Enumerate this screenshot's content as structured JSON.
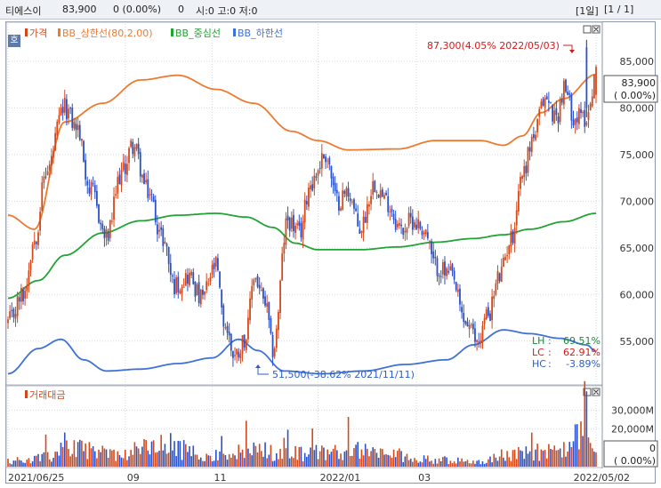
{
  "header": {
    "name": "티에스이",
    "price": "83,900",
    "change": "0 (0.00%)",
    "volume": "0",
    "ohl": "시:0 고:0 저:0",
    "period": "[1일]",
    "page": "[1 / 1]"
  },
  "hoga_label": "호",
  "legend": [
    {
      "text": "가격",
      "color": "#d24a1c"
    },
    {
      "text": "BB_상한선(80,2,00)",
      "color": "#ee7a30"
    },
    {
      "text": "BB_중심선",
      "color": "#22a335"
    },
    {
      "text": "BB_하한선",
      "color": "#3f71d6"
    }
  ],
  "volume_legend": {
    "text": "거래대금",
    "color": "#d24a1c"
  },
  "price_tag": {
    "value": "83,900",
    "change": "( 0.00%)"
  },
  "vol_tag": {
    "value": "0",
    "change": "( 0.00%)"
  },
  "annotations": {
    "high": "87,300(4.05% 2022/05/03)",
    "low": "51,500(-38.62% 2021/11/11)"
  },
  "stats": [
    {
      "label": "LH",
      "value": "69.51%",
      "color": "#1b8a3a"
    },
    {
      "label": "LC",
      "value": "62.91%",
      "color": "#d21c1c"
    },
    {
      "label": "HC",
      "value": "-3.89%",
      "color": "#2c5cc8"
    }
  ],
  "colors": {
    "up": "#d24a1c",
    "down": "#2a51c9",
    "upper": "#ee7a30",
    "mid": "#22a335",
    "lower": "#3f71d6"
  },
  "chart_data": {
    "type": "line",
    "y_ticks": [
      "85,000",
      "80,000",
      "75,000",
      "70,000",
      "65,000",
      "60,000",
      "55,000"
    ],
    "y_tick_values": [
      85000,
      80000,
      75000,
      70000,
      65000,
      60000,
      55000
    ],
    "ylim": [
      50500,
      89000
    ],
    "x_ticks": [
      "2021/06/25",
      "09",
      "11",
      "2022/01",
      "03",
      "2022/05/02"
    ],
    "vol_y_ticks": [
      "30,000M",
      "20,000M"
    ],
    "vol_y_tick_values": [
      30000,
      20000
    ],
    "vol_ylim": [
      0,
      42000
    ],
    "price_anchors": [
      [
        0,
        57000
      ],
      [
        8,
        60000
      ],
      [
        14,
        66000
      ],
      [
        20,
        73000
      ],
      [
        30,
        80000
      ],
      [
        36,
        78000
      ],
      [
        44,
        71000
      ],
      [
        52,
        66000
      ],
      [
        60,
        73000
      ],
      [
        66,
        76000
      ],
      [
        74,
        71000
      ],
      [
        82,
        66000
      ],
      [
        88,
        61000
      ],
      [
        96,
        62000
      ],
      [
        102,
        59500
      ],
      [
        110,
        63000
      ],
      [
        114,
        57000
      ],
      [
        120,
        53500
      ],
      [
        126,
        55500
      ],
      [
        130,
        62000
      ],
      [
        136,
        59000
      ],
      [
        140,
        54000
      ],
      [
        148,
        68000
      ],
      [
        154,
        66500
      ],
      [
        160,
        72000
      ],
      [
        168,
        75000
      ],
      [
        174,
        70000
      ],
      [
        180,
        71000
      ],
      [
        186,
        67000
      ],
      [
        194,
        72000
      ],
      [
        200,
        70000
      ],
      [
        208,
        67000
      ],
      [
        214,
        68000
      ],
      [
        220,
        67000
      ],
      [
        226,
        63000
      ],
      [
        234,
        62000
      ],
      [
        242,
        57000
      ],
      [
        248,
        55000
      ],
      [
        254,
        58000
      ],
      [
        260,
        62000
      ],
      [
        266,
        66000
      ],
      [
        272,
        73000
      ],
      [
        278,
        77000
      ],
      [
        284,
        81000
      ],
      [
        290,
        79000
      ],
      [
        294,
        82000
      ],
      [
        300,
        79000
      ],
      [
        306,
        79000
      ],
      [
        311,
        83900
      ]
    ],
    "upper_anchors": [
      [
        0,
        68500
      ],
      [
        14,
        67000
      ],
      [
        30,
        78500
      ],
      [
        50,
        80500
      ],
      [
        70,
        83000
      ],
      [
        90,
        83500
      ],
      [
        110,
        82000
      ],
      [
        130,
        80500
      ],
      [
        150,
        77500
      ],
      [
        164,
        76500
      ],
      [
        180,
        75500
      ],
      [
        206,
        75600
      ],
      [
        226,
        76500
      ],
      [
        250,
        76500
      ],
      [
        262,
        76000
      ],
      [
        272,
        77000
      ],
      [
        282,
        79500
      ],
      [
        294,
        81000
      ],
      [
        311,
        83600
      ]
    ],
    "mid_anchors": [
      [
        0,
        59600
      ],
      [
        16,
        61500
      ],
      [
        30,
        64200
      ],
      [
        50,
        66600
      ],
      [
        70,
        67900
      ],
      [
        90,
        68500
      ],
      [
        110,
        68700
      ],
      [
        126,
        68300
      ],
      [
        140,
        67200
      ],
      [
        152,
        65500
      ],
      [
        164,
        64800
      ],
      [
        186,
        64800
      ],
      [
        206,
        65100
      ],
      [
        226,
        65600
      ],
      [
        246,
        66000
      ],
      [
        262,
        66400
      ],
      [
        276,
        67000
      ],
      [
        294,
        67800
      ],
      [
        311,
        68700
      ]
    ],
    "lower_anchors": [
      [
        0,
        51500
      ],
      [
        16,
        54200
      ],
      [
        28,
        55200
      ],
      [
        40,
        53000
      ],
      [
        52,
        51800
      ],
      [
        70,
        52000
      ],
      [
        90,
        52600
      ],
      [
        108,
        53200
      ],
      [
        122,
        55200
      ],
      [
        132,
        54000
      ],
      [
        146,
        51800
      ],
      [
        166,
        51500
      ],
      [
        188,
        51800
      ],
      [
        210,
        52500
      ],
      [
        232,
        53000
      ],
      [
        246,
        54600
      ],
      [
        262,
        56200
      ],
      [
        276,
        55800
      ],
      [
        292,
        55300
      ],
      [
        306,
        54600
      ],
      [
        311,
        53900
      ]
    ],
    "volume_anchors": [
      [
        0,
        3500
      ],
      [
        24,
        5500
      ],
      [
        27,
        13000
      ],
      [
        60,
        7000
      ],
      [
        76,
        12000
      ],
      [
        120,
        5500
      ],
      [
        124,
        11000
      ],
      [
        150,
        7000
      ],
      [
        172,
        9000
      ],
      [
        180,
        10000
      ],
      [
        200,
        7500
      ],
      [
        224,
        4000
      ],
      [
        250,
        3000
      ],
      [
        262,
        6500
      ],
      [
        276,
        9000
      ],
      [
        292,
        8000
      ],
      [
        300,
        16000
      ],
      [
        303,
        24000
      ],
      [
        306,
        40000
      ],
      [
        308,
        10000
      ],
      [
        311,
        4000
      ]
    ],
    "xlabel": "",
    "ylabel": ""
  }
}
